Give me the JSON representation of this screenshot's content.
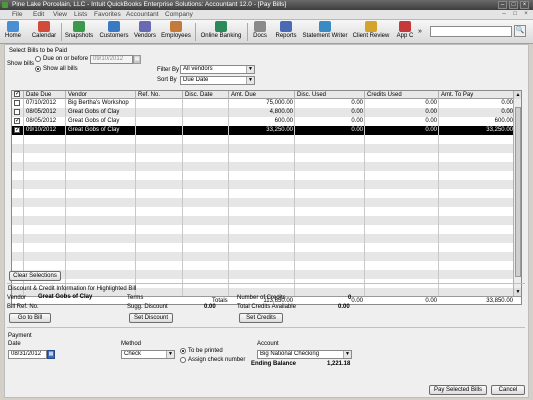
{
  "window": {
    "title": "Pine Lake Porcelain, LLC  - Intuit QuickBooks Enterprise Solutions: Accountant 12.0 - [Pay Bills]",
    "controls": [
      "–",
      "□",
      "×"
    ]
  },
  "menu": [
    "File",
    "Edit",
    "View",
    "Lists",
    "Favorites",
    "Accountant",
    "Company"
  ],
  "menu_controls": [
    "–",
    "□",
    "×"
  ],
  "toolbar": {
    "buttons": [
      {
        "label": "Home",
        "icon": "home-icon",
        "color": "#4a8fd4"
      },
      {
        "label": "Calendar",
        "icon": "calendar-icon",
        "color": "#d44a3a"
      },
      {
        "label": "Snapshots",
        "icon": "snapshots-icon",
        "color": "#3a9a4a"
      },
      {
        "label": "Customers",
        "icon": "customers-icon",
        "color": "#3a7ac4"
      },
      {
        "label": "Vendors",
        "icon": "vendors-icon",
        "color": "#6a6ab4"
      },
      {
        "label": "Employees",
        "icon": "employees-icon",
        "color": "#c47a3a"
      },
      {
        "label": "Online Banking",
        "icon": "online-banking-icon",
        "color": "#2a8a5a"
      },
      {
        "label": "Docs",
        "icon": "docs-icon",
        "color": "#8a8a8a"
      },
      {
        "label": "Reports",
        "icon": "reports-icon",
        "color": "#4a6ab4"
      },
      {
        "label": "Statement Writer",
        "icon": "statement-writer-icon",
        "color": "#3a8ac4"
      },
      {
        "label": "Client Review",
        "icon": "client-review-icon",
        "color": "#d4a42a"
      },
      {
        "label": "App C",
        "icon": "app-center-icon",
        "color": "#c43a3a"
      }
    ],
    "search_icon": "🔍",
    "overflow": "»"
  },
  "select_bills": {
    "heading": "Select Bills to be Paid",
    "show_bills_label": "Show bills",
    "option_due": "Due on or before",
    "due_date": "09/10/2012",
    "option_all": "Show all bills",
    "filter_by_label": "Filter By",
    "filter_by_value": "All vendors",
    "sort_by_label": "Sort By",
    "sort_by_value": "Due Date"
  },
  "grid": {
    "columns": [
      "Date Due",
      "Vendor",
      "Ref. No.",
      "Disc. Date",
      "Amt. Due",
      "Disc. Used",
      "Credits Used",
      "Amt. To Pay"
    ],
    "rows": [
      {
        "checked": false,
        "date_due": "07/10/2012",
        "vendor": "Big Bertha's Workshop",
        "ref_no": "",
        "disc_date": "",
        "amt_due": "75,000.00",
        "disc_used": "0.00",
        "credits_used": "0.00",
        "amt_to_pay": "0.00"
      },
      {
        "checked": false,
        "date_due": "08/05/2012",
        "vendor": "Great Gobs of Clay",
        "ref_no": "",
        "disc_date": "",
        "amt_due": "4,800.00",
        "disc_used": "0.00",
        "credits_used": "0.00",
        "amt_to_pay": "0.00"
      },
      {
        "checked": true,
        "date_due": "08/05/2012",
        "vendor": "Great Gobs of Clay",
        "ref_no": "",
        "disc_date": "",
        "amt_due": "600.00",
        "disc_used": "0.00",
        "credits_used": "0.00",
        "amt_to_pay": "600.00"
      },
      {
        "checked": true,
        "date_due": "09/10/2012",
        "vendor": "Great Gobs of Clay",
        "ref_no": "",
        "disc_date": "",
        "amt_due": "33,250.00",
        "disc_used": "0.00",
        "credits_used": "0.00",
        "amt_to_pay": "33,250.00"
      }
    ],
    "checkmark": "✓",
    "totals_label": "Totals",
    "total_amt_due": "113,650.00",
    "total_disc_used": "0.00",
    "total_credits_used": "0.00",
    "total_amt_to_pay": "33,850.00",
    "scroll_up": "▲",
    "scroll_down": "▼"
  },
  "clear_selections": "Clear Selections",
  "discount": {
    "heading": "Discount & Credit Information for Highlighted Bill",
    "vendor_label": "Vendor",
    "vendor_value": "Great Gobs of Clay",
    "bill_ref_label": "Bill Ref. No.",
    "terms_label": "Terms",
    "sugg_discount_label": "Sugg. Discount",
    "sugg_discount_value": "0.00",
    "num_credits_label": "Number of Credits",
    "num_credits_value": "0",
    "total_credits_label": "Total Credits Available",
    "total_credits_value": "0.00",
    "go_to_bill": "Go to Bill",
    "set_discount": "Set Discount",
    "set_credits": "Set Credits"
  },
  "payment": {
    "heading": "Payment",
    "date_label": "Date",
    "date_value": "08/31/2012",
    "method_label": "Method",
    "method_value": "Check",
    "to_be_printed": "To be printed",
    "assign_check": "Assign check number",
    "account_label": "Account",
    "account_value": "Big National Checking",
    "ending_balance_label": "Ending Balance",
    "ending_balance_value": "1,221.18"
  },
  "buttons": {
    "pay_selected": "Pay Selected Bills",
    "cancel": "Cancel"
  },
  "dropdown_arrow": "▼",
  "calendar_glyph": "▦"
}
